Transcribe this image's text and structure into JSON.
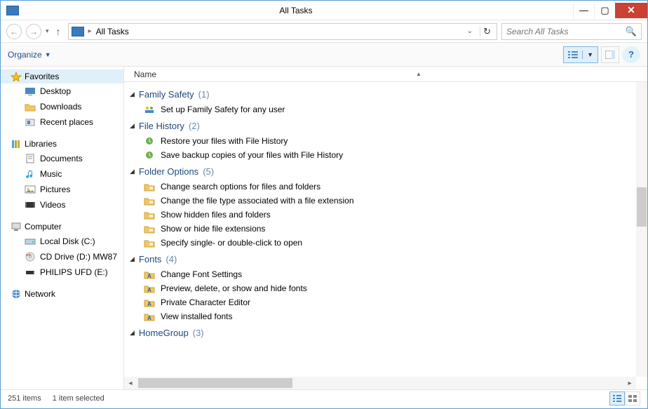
{
  "titlebar": {
    "title": "All Tasks"
  },
  "nav": {
    "location": "All Tasks",
    "search_placeholder": "Search All Tasks"
  },
  "toolbar": {
    "organize_label": "Organize"
  },
  "sidebar": {
    "groups": [
      {
        "label": "Favorites",
        "items": [
          {
            "label": "Desktop",
            "icon": "desktop"
          },
          {
            "label": "Downloads",
            "icon": "folder"
          },
          {
            "label": "Recent places",
            "icon": "recent"
          }
        ]
      },
      {
        "label": "Libraries",
        "items": [
          {
            "label": "Documents",
            "icon": "doc"
          },
          {
            "label": "Music",
            "icon": "music"
          },
          {
            "label": "Pictures",
            "icon": "pic"
          },
          {
            "label": "Videos",
            "icon": "video"
          }
        ]
      },
      {
        "label": "Computer",
        "items": [
          {
            "label": "Local Disk (C:)",
            "icon": "hdd"
          },
          {
            "label": "CD Drive (D:) MW87",
            "icon": "cd"
          },
          {
            "label": "PHILIPS UFD (E:)",
            "icon": "usb"
          }
        ]
      },
      {
        "label": "Network",
        "items": []
      }
    ]
  },
  "columns": {
    "name": "Name"
  },
  "groups": [
    {
      "title": "Family Safety",
      "count": 1,
      "tasks": [
        {
          "label": "Set up Family Safety for any user",
          "icon": "family"
        }
      ]
    },
    {
      "title": "File History",
      "count": 2,
      "tasks": [
        {
          "label": "Restore your files with File History",
          "icon": "restore"
        },
        {
          "label": "Save backup copies of your files with File History",
          "icon": "backup"
        }
      ]
    },
    {
      "title": "Folder Options",
      "count": 5,
      "tasks": [
        {
          "label": "Change search options for files and folders",
          "icon": "folderopt"
        },
        {
          "label": "Change the file type associated with a file extension",
          "icon": "folderopt"
        },
        {
          "label": "Show hidden files and folders",
          "icon": "folderopt"
        },
        {
          "label": "Show or hide file extensions",
          "icon": "folderopt"
        },
        {
          "label": "Specify single- or double-click to open",
          "icon": "folderopt"
        }
      ]
    },
    {
      "title": "Fonts",
      "count": 4,
      "tasks": [
        {
          "label": "Change Font Settings",
          "icon": "font"
        },
        {
          "label": "Preview, delete, or show and hide fonts",
          "icon": "font"
        },
        {
          "label": "Private Character Editor",
          "icon": "font"
        },
        {
          "label": "View installed fonts",
          "icon": "font"
        }
      ]
    },
    {
      "title": "HomeGroup",
      "count": 3,
      "tasks": []
    }
  ],
  "status": {
    "total": "251 items",
    "selected": "1 item selected"
  }
}
